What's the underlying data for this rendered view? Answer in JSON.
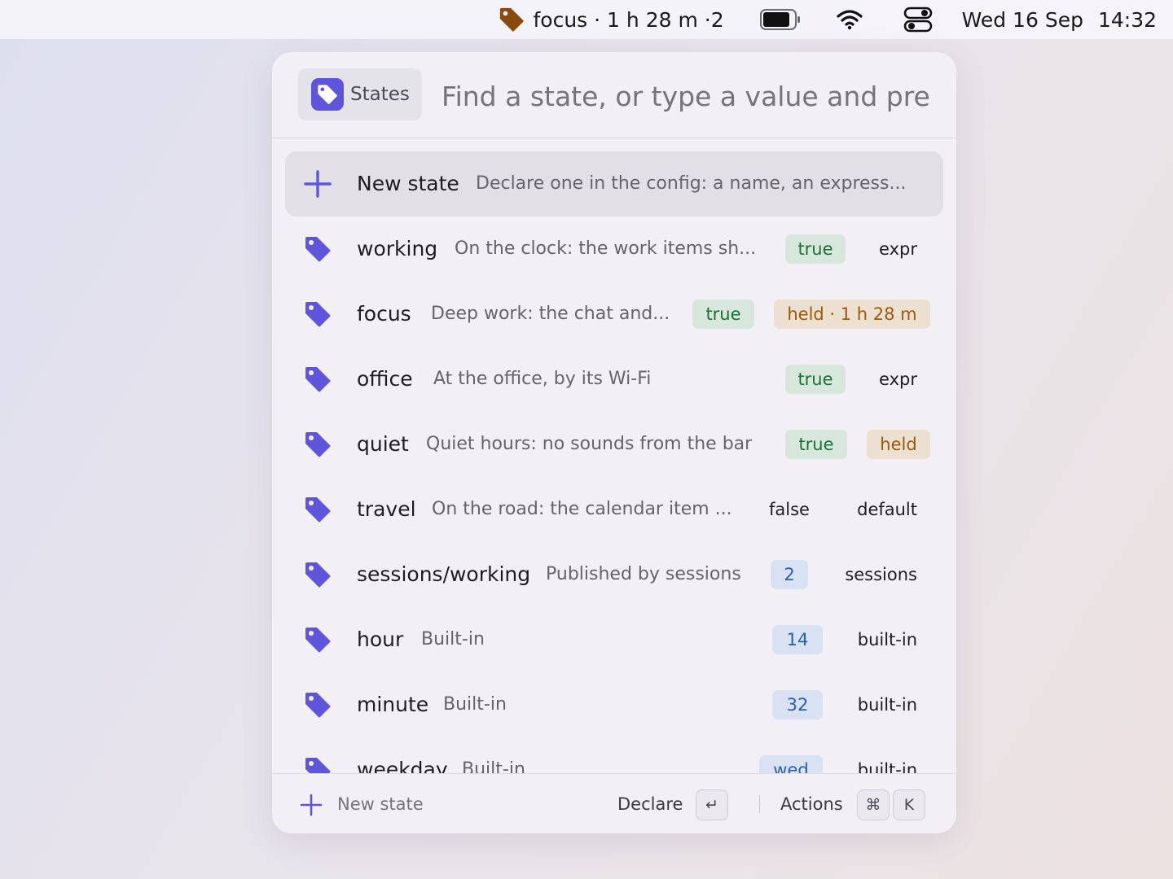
{
  "menubar": {
    "focus_status": "focus · 1 h 28 m ·2",
    "date": "Wed 16 Sep",
    "time": "14:32",
    "icons": [
      "tag-icon",
      "battery-icon",
      "wifi-icon",
      "control-center-icon"
    ]
  },
  "search": {
    "scope_label": "States",
    "placeholder": "Find a state, or type a value and press"
  },
  "new_state_row": {
    "label": "New state",
    "description": "Declare one in the config: a name, an express..."
  },
  "states": [
    {
      "name": "working",
      "description": "On the clock: the work items sh...",
      "value": "true",
      "source": "expr"
    },
    {
      "name": "focus",
      "description": "Deep work: the chat and...",
      "value": "true",
      "source": "held · 1 h 28 m"
    },
    {
      "name": "office",
      "description": "At the office, by its Wi-Fi",
      "value": "true",
      "source": "expr"
    },
    {
      "name": "quiet",
      "description": "Quiet hours: no sounds from the bar",
      "value": "true",
      "source": "held"
    },
    {
      "name": "travel",
      "description": "On the road: the calendar item ...",
      "value": "false",
      "source": "default"
    },
    {
      "name": "sessions/working",
      "description": "Published by sessions",
      "value": "2",
      "source": "sessions"
    },
    {
      "name": "hour",
      "description": "Built-in",
      "value": "14",
      "source": "built-in"
    },
    {
      "name": "minute",
      "description": "Built-in",
      "value": "32",
      "source": "built-in"
    },
    {
      "name": "weekday",
      "description": "Built-in",
      "value": "wed",
      "source": "built-in"
    }
  ],
  "footer": {
    "new_label": "New state",
    "declare_label": "Declare",
    "declare_key": "↵",
    "actions_label": "Actions",
    "actions_keys": [
      "⌘",
      "K"
    ]
  },
  "colors": {
    "accent": "#5f55dd",
    "true_badge": "#d8e7dc",
    "held_badge": "#ece0d1",
    "number_badge": "#d9e2f2",
    "menubar_tag": "#8a4a0c"
  }
}
